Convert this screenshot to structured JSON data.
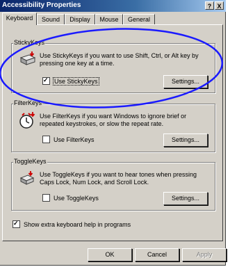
{
  "window": {
    "title": "Accessibility Properties",
    "help_button": "?",
    "close_button": "X"
  },
  "tabs": [
    {
      "label": "Keyboard",
      "active": true
    },
    {
      "label": "Sound",
      "active": false
    },
    {
      "label": "Display",
      "active": false
    },
    {
      "label": "Mouse",
      "active": false
    },
    {
      "label": "General",
      "active": false
    }
  ],
  "groups": {
    "sticky": {
      "label": "StickyKeys",
      "description": "Use StickyKeys if you want to use Shift, Ctrl, or Alt key by pressing one key at a time.",
      "checkbox_label": "Use StickyKeys",
      "checked": true,
      "settings_label": "Settings..."
    },
    "filter": {
      "label": "FilterKeys",
      "description": "Use FilterKeys if you want Windows to ignore brief or repeated keystrokes, or slow the repeat rate.",
      "checkbox_label": "Use FilterKeys",
      "checked": false,
      "settings_label": "Settings..."
    },
    "toggle": {
      "label": "ToggleKeys",
      "description": "Use ToggleKeys if you want to hear tones when pressing Caps Lock, Num Lock, and Scroll Lock.",
      "checkbox_label": "Use ToggleKeys",
      "checked": false,
      "settings_label": "Settings..."
    }
  },
  "extra_help": {
    "label": "Show extra keyboard help in programs",
    "checked": true
  },
  "footer": {
    "ok": "OK",
    "cancel": "Cancel",
    "apply": "Apply"
  },
  "colors": {
    "title_start": "#0a246a",
    "title_end": "#a6caf0",
    "face": "#d4d0c8",
    "annotation": "#1a1aff"
  }
}
